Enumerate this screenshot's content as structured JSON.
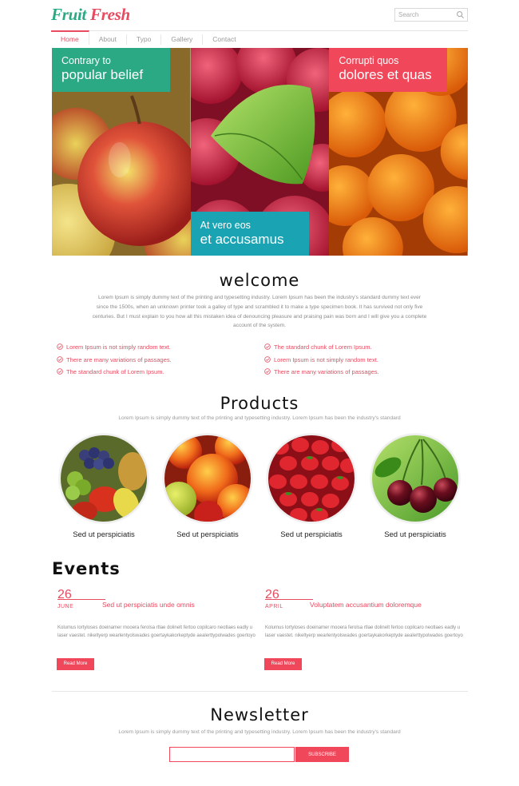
{
  "header": {
    "logo_part1": "Fruit",
    "logo_part2": "Fresh",
    "search_placeholder": "Search"
  },
  "nav": {
    "items": [
      "Home",
      "About",
      "Typo",
      "Gallery",
      "Contact"
    ],
    "active": "Home"
  },
  "hero": {
    "panels": [
      {
        "line1": "Contrary to",
        "line2": "popular belief",
        "caption_color": "#2aa984"
      },
      {
        "line1": "At vero eos",
        "line2": "et accusamus",
        "caption_color": "#1aa3b3"
      },
      {
        "line1": "Corrupti quos",
        "line2": "dolores et quas",
        "caption_color": "#f0475a"
      }
    ]
  },
  "welcome": {
    "title": "welcome",
    "text": "Lorem Ipsum is simply dummy text of the printing and typesetting industry. Lorem Ipsum has been the industry's standard dummy text ever since the 1500s, when an unknown printer took a galley of type and scrambled it to make a type specimen book. It has survived not only five centuries. But I must explain to you how all this mistaken idea of denouncing pleasure and praising pain was born and I will give you a complete account of the system.",
    "list_left": [
      "Lorem Ipsum is not simply random text.",
      "There are many variations of passages.",
      "The standard chunk of Lorem Ipsum."
    ],
    "list_right": [
      "The standard chunk of Lorem Ipsum.",
      "Lorem Ipsum is not simply random text.",
      "There are many variations of passages."
    ]
  },
  "products": {
    "title": "Products",
    "subtitle": "Lorem Ipsum is simply dummy text of the printing and typesetting industry. Lorem Ipsum has been the industry's standard",
    "items": [
      {
        "name": "Sed ut perspiciatis",
        "image": "mixed-fruit"
      },
      {
        "name": "Sed ut perspiciatis",
        "image": "plums"
      },
      {
        "name": "Sed ut perspiciatis",
        "image": "strawberries"
      },
      {
        "name": "Sed ut perspiciatis",
        "image": "cherries"
      }
    ]
  },
  "events": {
    "title": "Events",
    "items": [
      {
        "day": "26",
        "month": "JUNE",
        "title": "Sed ut perspiciatis unde omnis",
        "text": "Kolumus lortyloses doeinamer mooera ferolsa rtlae dolinelt fertoo copilcaro neotlaes eadly u laser vaestet. nikeltyerp wearlentyolswades goertaykakorkeptyde aealerttypolwades goertoyo",
        "button": "Read More"
      },
      {
        "day": "26",
        "month": "APRIL",
        "title": "Voluptatem accusantium doloremque",
        "text": "Kolumus lortyloses doeinamer mooera ferolsa rtlae dolinelt fertoo copilcaro neotlaes eadly u laser vaestet. nikeltyerp wearlentyolswades goertaykakorkeptyde aealerttypolwades goertoyo",
        "button": "Read More"
      }
    ]
  },
  "newsletter": {
    "title": "Newsletter",
    "subtitle": "Lorem Ipsum is simply dummy text of the printing and typesetting industry. Lorem Ipsum has been the industry's standard",
    "input_value": "",
    "button": "SUBSCRIBE"
  },
  "colors": {
    "accent": "#f0475a",
    "green": "#2aa984",
    "teal": "#1aa3b3"
  }
}
